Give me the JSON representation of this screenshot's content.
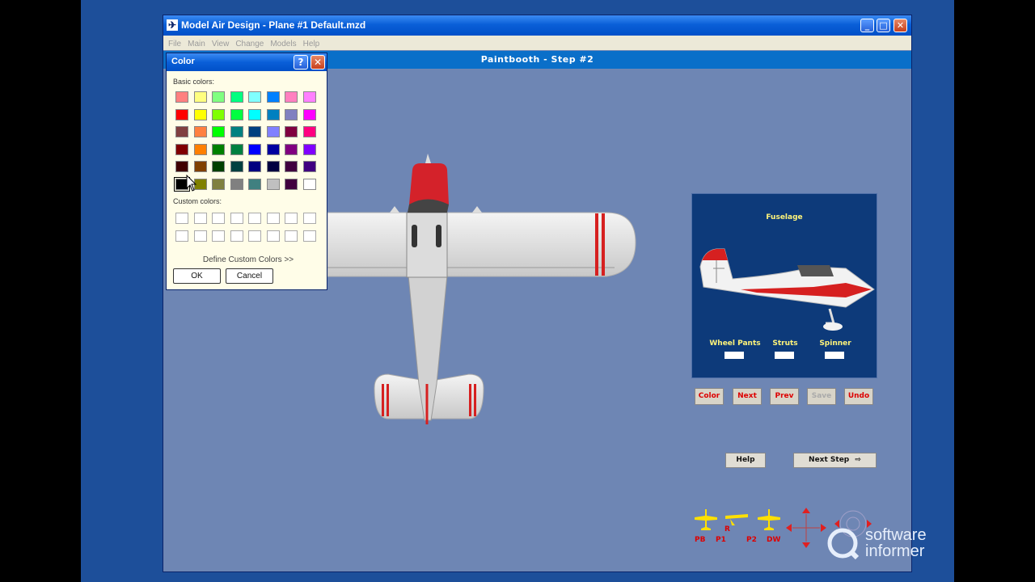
{
  "window": {
    "title": "Model Air Design - Plane #1  Default.mzd",
    "controls": {
      "minimize": "_",
      "maximize": "□",
      "close": "✕"
    }
  },
  "menu": [
    "File",
    "Main",
    "View",
    "Change",
    "Models",
    "Help"
  ],
  "page_title": "Paintbooth  -  Step #2",
  "color_dialog": {
    "title": "Color",
    "help_button": "?",
    "close_button": "✕",
    "basic_colors_label": "Basic colors:",
    "basic_colors": [
      [
        "#ff8080",
        "#ffff80",
        "#80ff80",
        "#00ff80",
        "#80ffff",
        "#0080ff",
        "#ff80c0",
        "#ff80ff"
      ],
      [
        "#ff0000",
        "#ffff00",
        "#80ff00",
        "#00ff40",
        "#00ffff",
        "#0080c0",
        "#8080c0",
        "#ff00ff"
      ],
      [
        "#804040",
        "#ff8040",
        "#00ff00",
        "#008080",
        "#004080",
        "#8080ff",
        "#800040",
        "#ff0080"
      ],
      [
        "#800000",
        "#ff8000",
        "#008000",
        "#008040",
        "#0000ff",
        "#0000a0",
        "#800080",
        "#8000ff"
      ],
      [
        "#400000",
        "#804000",
        "#004000",
        "#004040",
        "#000080",
        "#000040",
        "#400040",
        "#400080"
      ],
      [
        "#000000",
        "#808000",
        "#808040",
        "#808080",
        "#408080",
        "#c0c0c0",
        "#400040",
        "#ffffff"
      ]
    ],
    "selected_color": "#000000",
    "custom_colors_label": "Custom colors:",
    "custom_colors": [
      [
        "#ffffff",
        "#ffffff",
        "#ffffff",
        "#ffffff",
        "#ffffff",
        "#ffffff",
        "#ffffff",
        "#ffffff"
      ],
      [
        "#ffffff",
        "#ffffff",
        "#ffffff",
        "#ffffff",
        "#ffffff",
        "#ffffff",
        "#ffffff",
        "#ffffff"
      ]
    ],
    "define_custom": "Define Custom Colors >>",
    "ok": "OK",
    "cancel": "Cancel"
  },
  "preview_panel": {
    "heading": "Fuselage",
    "options": [
      {
        "label": "Wheel Pants"
      },
      {
        "label": "Struts"
      },
      {
        "label": "Spinner"
      }
    ]
  },
  "paint_buttons": {
    "color": "Color",
    "next": "Next",
    "prev": "Prev",
    "save": "Save",
    "undo": "Undo"
  },
  "help_button": "Help",
  "next_step_button": "Next Step",
  "view_nav": [
    "PB",
    "P1",
    "P2",
    "DW",
    "R"
  ],
  "watermark": {
    "line1": "software",
    "line2": "informer"
  },
  "colors": {
    "accent_red": "#dd2020",
    "label_yellow": "#fff47a",
    "panel_blue": "#0d3a7a",
    "work_area": "#6e86b4"
  }
}
